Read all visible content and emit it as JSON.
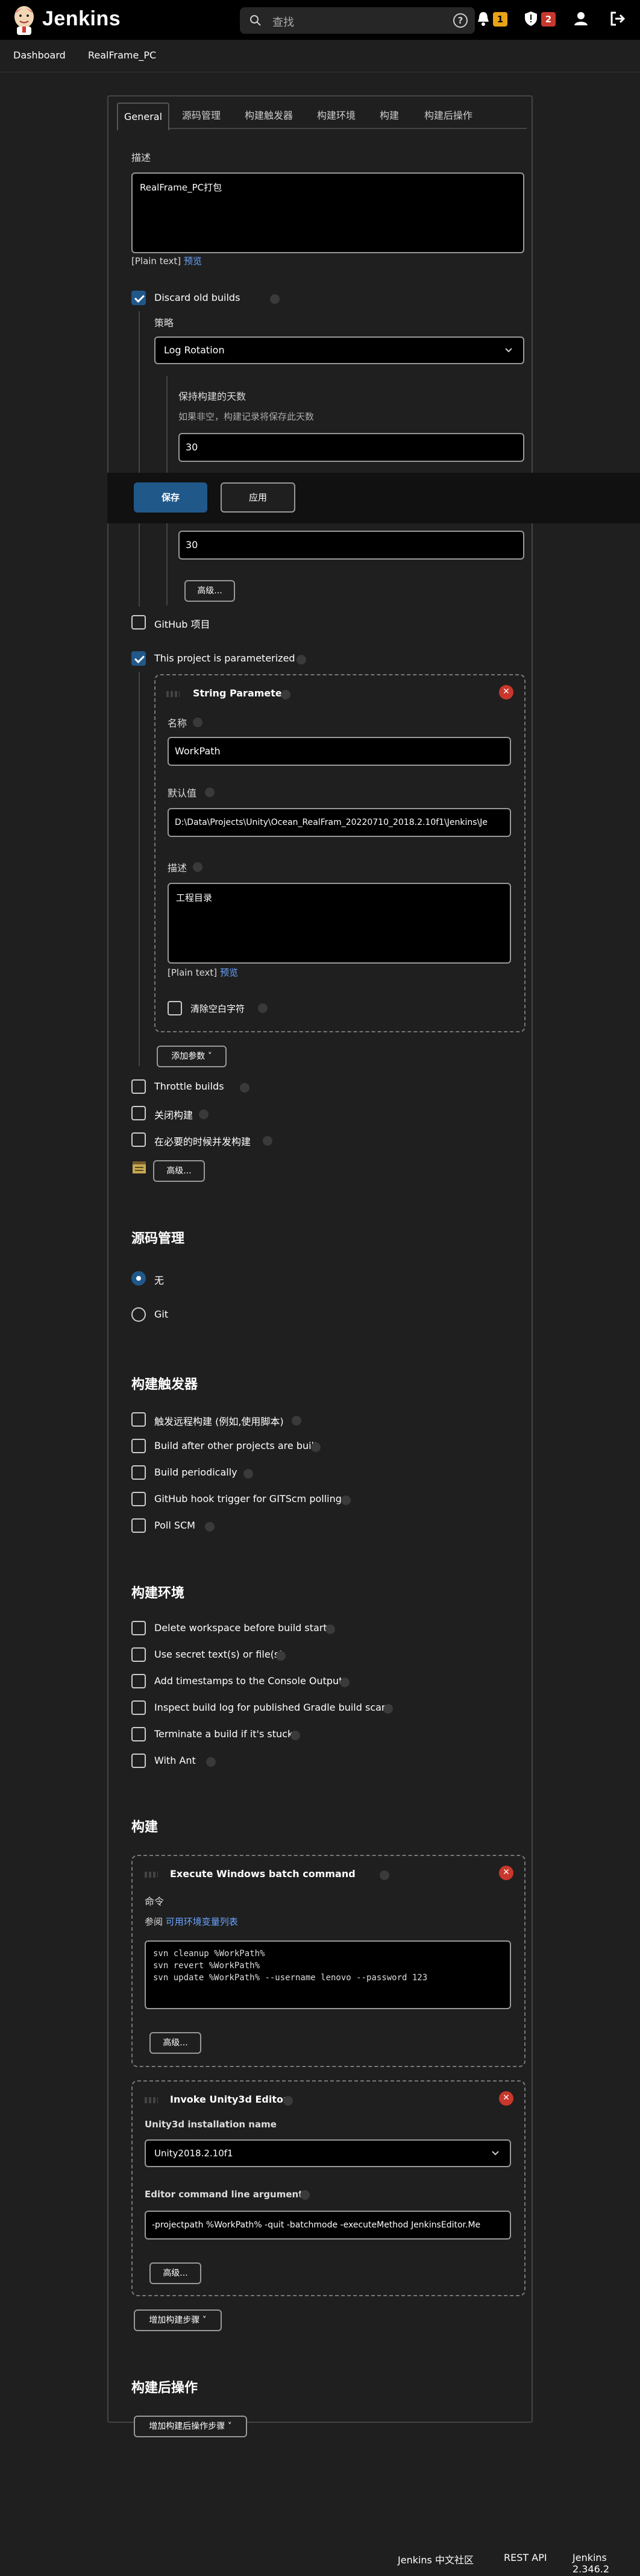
{
  "header": {
    "brand": "Jenkins",
    "search_placeholder": "查找",
    "help": "?",
    "notif_count": "1",
    "security_count": "2"
  },
  "breadcrumb": {
    "items": [
      "Dashboard",
      "RealFrame_PC"
    ]
  },
  "tabs": [
    "General",
    "源码管理",
    "构建触发器",
    "构建环境",
    "构建",
    "构建后操作"
  ],
  "general": {
    "description_label": "描述",
    "description_value": "RealFrame_PC打包",
    "plain_text": "[Plain text]",
    "preview": "预览",
    "discard_label": "Discard old builds",
    "strategy_label": "策略",
    "strategy_value": "Log Rotation",
    "keep_days_label": "保持构建的天数",
    "keep_days_hint": "如果非空，构建记录将保存此天数",
    "keep_days_value": "30",
    "keep_max_value": "30",
    "advanced": "高级...",
    "github_label": "GitHub 项目",
    "param_label": "This project is parameterized",
    "param": {
      "title": "String Parameter",
      "name_label": "名称",
      "name_value": "WorkPath",
      "default_label": "默认值",
      "default_value": "D:\\Data\\Projects\\Unity\\Ocean_RealFram_20220710_2018.2.10f1\\Jenkins\\Je",
      "desc_label": "描述",
      "desc_value": "工程目录",
      "plain_text": "[Plain text]",
      "preview": "预览",
      "trim_label": "清除空白字符"
    },
    "add_param": "添加参数",
    "throttle": "Throttle builds",
    "disable": "关闭构建",
    "concurrent": "在必要的时候并发构建",
    "advanced2": "高级..."
  },
  "save_bar": {
    "save": "保存",
    "apply": "应用"
  },
  "scm": {
    "title": "源码管理",
    "none": "无",
    "git": "Git"
  },
  "triggers": {
    "title": "构建触发器",
    "items": [
      "触发远程构建 (例如,使用脚本)",
      "Build after other projects are built",
      "Build periodically",
      "GitHub hook trigger for GITScm polling",
      "Poll SCM"
    ]
  },
  "env": {
    "title": "构建环境",
    "items": [
      "Delete workspace before build starts",
      "Use secret text(s) or file(s)",
      "Add timestamps to the Console Output",
      "Inspect build log for published Gradle build scans",
      "Terminate a build if it's stuck",
      "With Ant"
    ]
  },
  "build": {
    "title": "构建",
    "batch": {
      "title": "Execute Windows batch command",
      "cmd_label": "命令",
      "ref_prefix": "参阅 ",
      "ref_link": "可用环境变量列表",
      "code": "svn cleanup %WorkPath%\nsvn revert %WorkPath%\nsvn update %WorkPath% --username lenovo --password 123",
      "advanced": "高级..."
    },
    "unity": {
      "title": "Invoke Unity3d Editor",
      "install_label": "Unity3d installation name",
      "install_value": "Unity2018.2.10f1",
      "args_label": "Editor command line arguments",
      "args_value": "-projectpath %WorkPath% -quit -batchmode -executeMethod JenkinsEditor.Me",
      "advanced": "高级..."
    },
    "add_step": "增加构建步骤"
  },
  "post": {
    "title": "构建后操作",
    "add": "增加构建后操作步骤"
  },
  "footer": {
    "community": "Jenkins 中文社区",
    "rest": "REST API",
    "version": "Jenkins 2.346.2"
  }
}
